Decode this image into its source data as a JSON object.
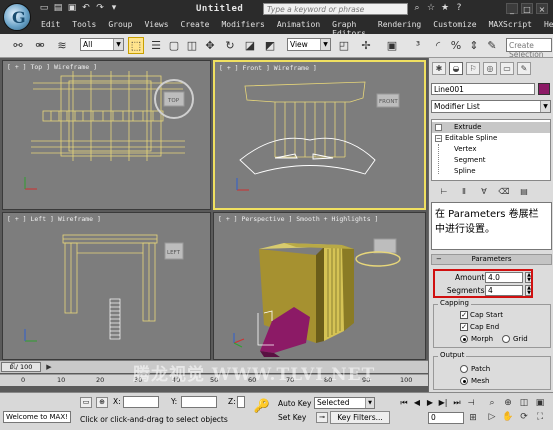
{
  "window": {
    "title": "Untitled",
    "search_placeholder": "Type a keyword or phrase"
  },
  "menu": [
    "Edit",
    "Tools",
    "Group",
    "Views",
    "Create",
    "Modifiers",
    "Animation",
    "Graph Editors",
    "Rendering",
    "Customize",
    "MAXScript",
    "Help"
  ],
  "toolbar": {
    "selection_filter": "All",
    "reference_coord": "View",
    "named_selection_placeholder": "Create Selection Se"
  },
  "viewports": {
    "top": {
      "label": "[ + ] Top ] Wireframe ]"
    },
    "front": {
      "label": "[ + ] Front ] Wireframe ]"
    },
    "left": {
      "label": "[ + ] Left ] Wireframe ]"
    },
    "perspective": {
      "label": "[ + ] Perspective ] Smooth + Highlights ]"
    }
  },
  "view_cube": {
    "top": "TOP",
    "front": "FRONT",
    "left": "LEFT"
  },
  "command_panel": {
    "object_name": "Line001",
    "object_color": "#8c1a66",
    "modifier_list": "Modifier List",
    "stack": [
      "Extrude",
      "Editable Spline",
      "Vertex",
      "Segment",
      "Spline"
    ],
    "callout": "在 Parameters 卷展栏中进行设置。",
    "parameters_title": "Parameters",
    "amount_label": "Amount:",
    "amount_value": "4.0",
    "segments_label": "Segments:",
    "segments_value": "4",
    "capping_title": "Capping",
    "cap_start": "Cap Start",
    "cap_end": "Cap End",
    "morph": "Morph",
    "grid": "Grid",
    "output_title": "Output",
    "patch": "Patch",
    "mesh": "Mesh"
  },
  "timeline": {
    "slider": "0 / 100",
    "ticks": [
      "0",
      "10",
      "20",
      "30",
      "40",
      "50",
      "60",
      "70",
      "80",
      "90",
      "100"
    ]
  },
  "status": {
    "listener": "Welcome to MAX!",
    "x_label": "X:",
    "y_label": "Y:",
    "z_label": "Z:",
    "prompt": "Click or click-and-drag to select objects",
    "auto_key": "Auto Key",
    "set_key": "Set Key",
    "key_mode": "Selected",
    "key_filters": "Key Filters...",
    "frame": "0"
  },
  "watermark": "腾龙视觉 WWW.TLVI.NET"
}
